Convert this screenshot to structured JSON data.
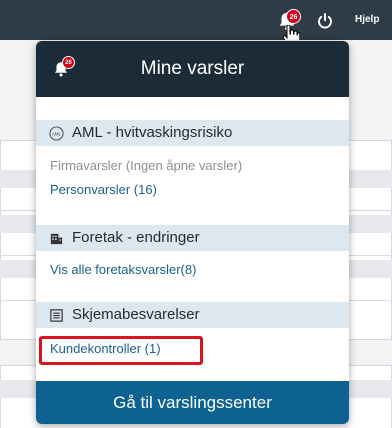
{
  "topbar": {
    "notification_count": "26",
    "help_label": "Hjelp"
  },
  "dropdown": {
    "title": "Mine varsler",
    "badge_count": "26",
    "sections": [
      {
        "title": "AML - hvitvaskingsrisiko",
        "icon": "aml-icon",
        "icon_text": "AML",
        "items": [
          {
            "label": "Firmavarsler (Ingen åpne varsler)",
            "enabled": false
          },
          {
            "label": "Personvarsler (16)",
            "enabled": true
          }
        ]
      },
      {
        "title": "Foretak - endringer",
        "icon": "building-icon",
        "items": [
          {
            "label": "Vis alle foretaksvarsler(8)",
            "enabled": true
          }
        ]
      },
      {
        "title": "Skjemabesvarelser",
        "icon": "form-list-icon",
        "items": [
          {
            "label": "Kundekontroller (1)",
            "enabled": true,
            "highlighted": true
          }
        ]
      }
    ],
    "footer_button": "Gå til varslingssenter"
  },
  "colors": {
    "topbar": "#2f3c48",
    "dropdown_header": "#1c2b38",
    "section_header": "#dde7ef",
    "link": "#1b5e8c",
    "badge": "#d0021b",
    "footer_button": "#0e6291",
    "highlight": "#d9141c"
  }
}
